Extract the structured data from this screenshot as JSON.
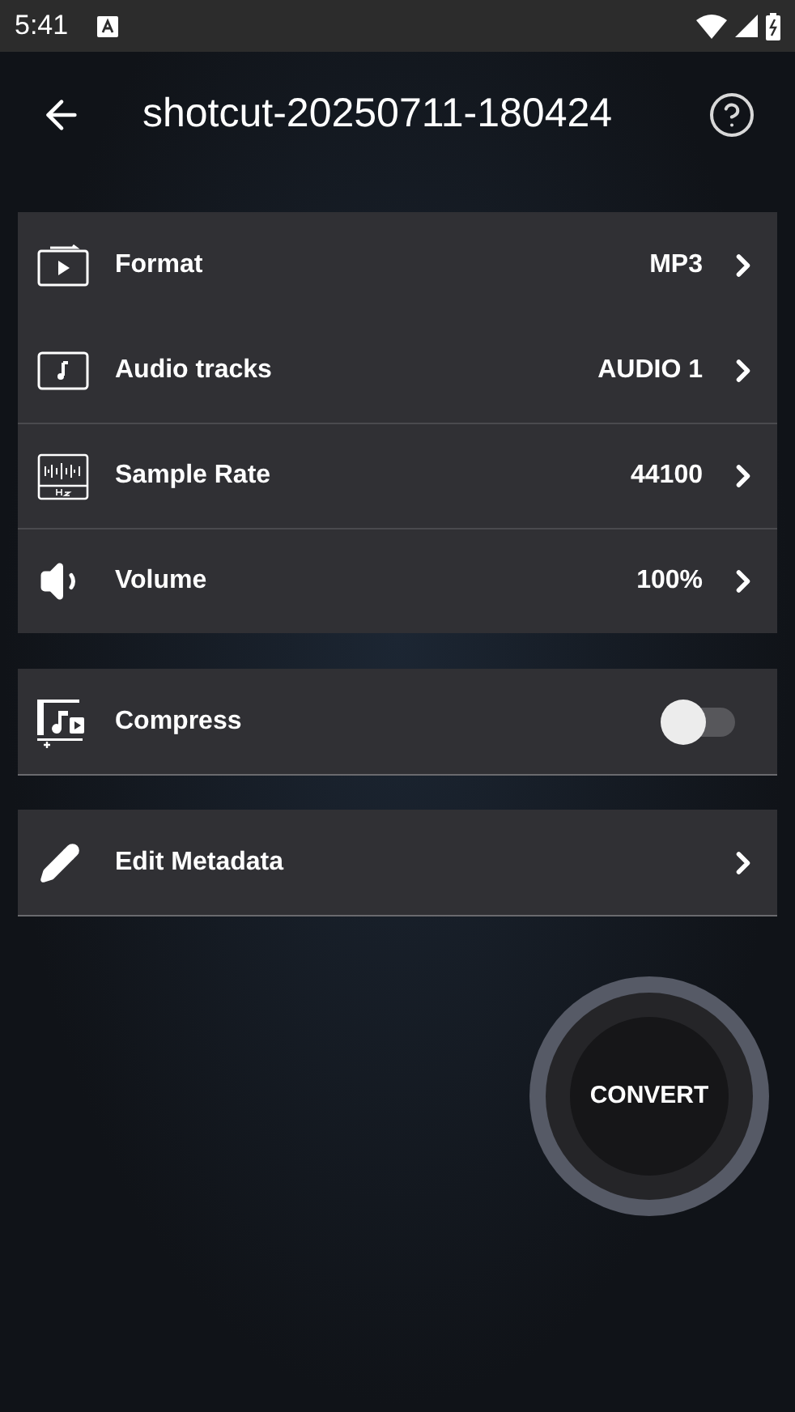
{
  "status_bar": {
    "time": "5:41"
  },
  "header": {
    "title": "shotcut-20250711-180424"
  },
  "settings": [
    {
      "kind": "format",
      "label": "Format",
      "value": "MP3"
    },
    {
      "kind": "audio",
      "label": "Audio tracks",
      "value": "AUDIO 1"
    },
    {
      "kind": "rate",
      "label": "Sample Rate",
      "value": "44100"
    },
    {
      "kind": "volume",
      "label": "Volume",
      "value": "100%"
    }
  ],
  "compress": {
    "label": "Compress",
    "on": false
  },
  "metadata": {
    "label": "Edit Metadata"
  },
  "convert_button": {
    "label": "CONVERT"
  }
}
